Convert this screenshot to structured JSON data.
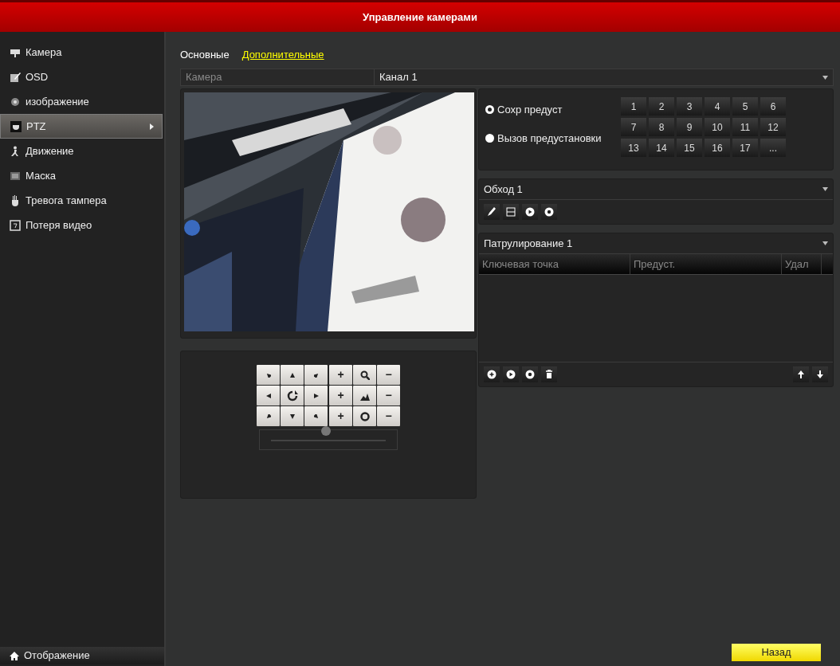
{
  "window": {
    "title": "Управление камерами"
  },
  "sidebar": {
    "items": [
      {
        "label": "Камера",
        "selected": false
      },
      {
        "label": "OSD",
        "selected": false
      },
      {
        "label": "изображение",
        "selected": false
      },
      {
        "label": "PTZ",
        "selected": true
      },
      {
        "label": "Движение",
        "selected": false
      },
      {
        "label": "Маска",
        "selected": false
      },
      {
        "label": "Тревога тампера",
        "selected": false
      },
      {
        "label": "Потеря видео",
        "selected": false
      }
    ],
    "footer": {
      "label": "Отображение"
    }
  },
  "tabs": [
    {
      "label": "Основные",
      "selected": false
    },
    {
      "label": "Дополнительные",
      "selected": true
    }
  ],
  "camera": {
    "label": "Камера",
    "value": "Канал 1"
  },
  "ptz": {
    "lens_rows": [
      {
        "increase": "+",
        "decrease": "−"
      },
      {
        "increase": "+",
        "decrease": "−"
      },
      {
        "increase": "+",
        "decrease": "−"
      }
    ],
    "speed": {
      "level": 0.48
    }
  },
  "presets": {
    "modes": [
      {
        "label": "Сохр предуст",
        "selected": true
      },
      {
        "label": "Вызов предустановки",
        "selected": false
      }
    ],
    "buttons": [
      "1",
      "2",
      "3",
      "4",
      "5",
      "6",
      "7",
      "8",
      "9",
      "10",
      "11",
      "12",
      "13",
      "14",
      "15",
      "16",
      "17",
      "..."
    ]
  },
  "tour": {
    "value": "Обход 1"
  },
  "patrol": {
    "value": "Патрулирование 1",
    "columns": [
      "Ключевая точка",
      "Предуст.",
      "Удал"
    ]
  },
  "back_button": "Назад"
}
